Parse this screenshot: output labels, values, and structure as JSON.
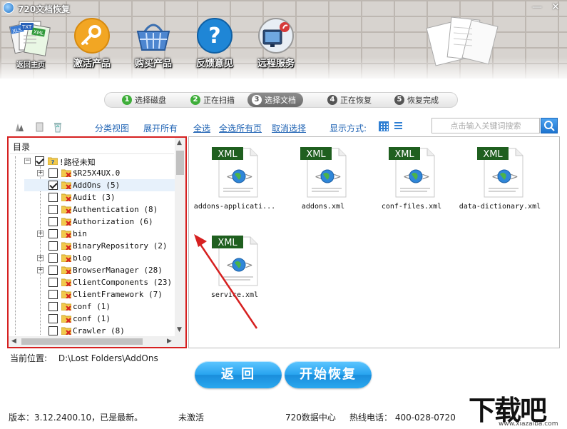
{
  "window": {
    "title": "720文档恢复",
    "minimize": "—",
    "close": "✕"
  },
  "nav": {
    "home": "返回主页",
    "activate": "激活产品",
    "buy": "购买产品",
    "feedback": "反馈意见",
    "remote": "远程服务"
  },
  "steps": [
    {
      "num": "1",
      "label": "选择磁盘"
    },
    {
      "num": "2",
      "label": "正在扫描"
    },
    {
      "num": "3",
      "label": "选择文档"
    },
    {
      "num": "4",
      "label": "正在恢复"
    },
    {
      "num": "5",
      "label": "恢复完成"
    }
  ],
  "current_step": 3,
  "toolbar": {
    "category_view": "分类视图",
    "expand_all": "展开所有",
    "select_all": "全选",
    "select_all_pages": "全选所有页",
    "cancel_selection": "取消选择",
    "display_mode": "显示方式:",
    "search_placeholder": "点击输入关键词搜索"
  },
  "tree": {
    "header": "目录",
    "root": {
      "label": "!路径未知",
      "checked": true
    },
    "items": [
      {
        "label": "$R25X4UX.0",
        "expandable": true,
        "checked": false
      },
      {
        "label": "AddOns (5)",
        "expandable": false,
        "checked": true,
        "selected": true
      },
      {
        "label": "Audit (3)",
        "expandable": false,
        "checked": false
      },
      {
        "label": "Authentication (8)",
        "expandable": false,
        "checked": false
      },
      {
        "label": "Authorization (6)",
        "expandable": false,
        "checked": false
      },
      {
        "label": "bin",
        "expandable": true,
        "checked": false
      },
      {
        "label": "BinaryRepository (2)",
        "expandable": false,
        "checked": false
      },
      {
        "label": "blog",
        "expandable": true,
        "checked": false
      },
      {
        "label": "BrowserManager (28)",
        "expandable": true,
        "checked": false
      },
      {
        "label": "ClientComponents (23)",
        "expandable": false,
        "checked": false
      },
      {
        "label": "ClientFramework (7)",
        "expandable": false,
        "checked": false
      },
      {
        "label": "conf (1)",
        "expandable": false,
        "checked": false
      },
      {
        "label": "conf (1)",
        "expandable": false,
        "checked": false
      },
      {
        "label": "Crawler (8)",
        "expandable": false,
        "checked": false
      }
    ]
  },
  "files": [
    {
      "name": "addons-applicati...",
      "badge": "XML"
    },
    {
      "name": "addons.xml",
      "badge": "XML"
    },
    {
      "name": "conf-files.xml",
      "badge": "XML"
    },
    {
      "name": "data-dictionary.xml",
      "badge": "XML"
    },
    {
      "name": "service.xml",
      "badge": "XML"
    }
  ],
  "path": {
    "label": "当前位置:",
    "value": "D:\\Lost Folders\\AddOns"
  },
  "buttons": {
    "back": "返 回",
    "start": "开始恢复"
  },
  "status": {
    "version": "版本：3.12.2400.10，已是最新。",
    "activation": "未激活",
    "center": "720数据中心",
    "hotline": "热线电话： 400-028-0720"
  },
  "watermark": {
    "big": "下载吧",
    "url": "www.xiazaiba.com"
  },
  "colors": {
    "accent": "#1f63b4",
    "highlight_border": "#d62020",
    "button_blue": "#27a3ef",
    "step_done": "#3fae3a"
  }
}
